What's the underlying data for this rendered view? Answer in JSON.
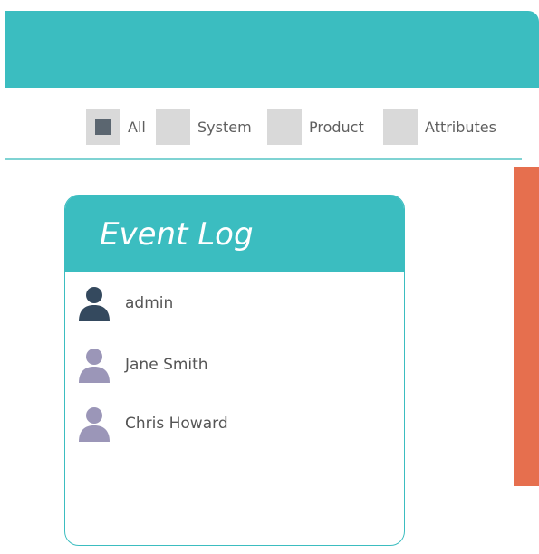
{
  "filters": [
    {
      "label": "All",
      "checked": true
    },
    {
      "label": "System",
      "checked": false
    },
    {
      "label": "Product",
      "checked": false
    },
    {
      "label": "Attributes",
      "checked": false
    }
  ],
  "event_log": {
    "title": "Event Log",
    "entries": [
      {
        "user": "admin",
        "icon": "user-icon",
        "icon_color": "#34495e"
      },
      {
        "user": "Jane Smith",
        "icon": "user-icon",
        "icon_color": "#9b96b8"
      },
      {
        "user": "Chris Howard",
        "icon": "user-icon",
        "icon_color": "#9b96b8"
      }
    ]
  },
  "colors": {
    "accent": "#3bbdc0",
    "panel": "#e66f4e",
    "checkbox": "#d9d9d9",
    "checkbox_mark": "#5b6670"
  }
}
